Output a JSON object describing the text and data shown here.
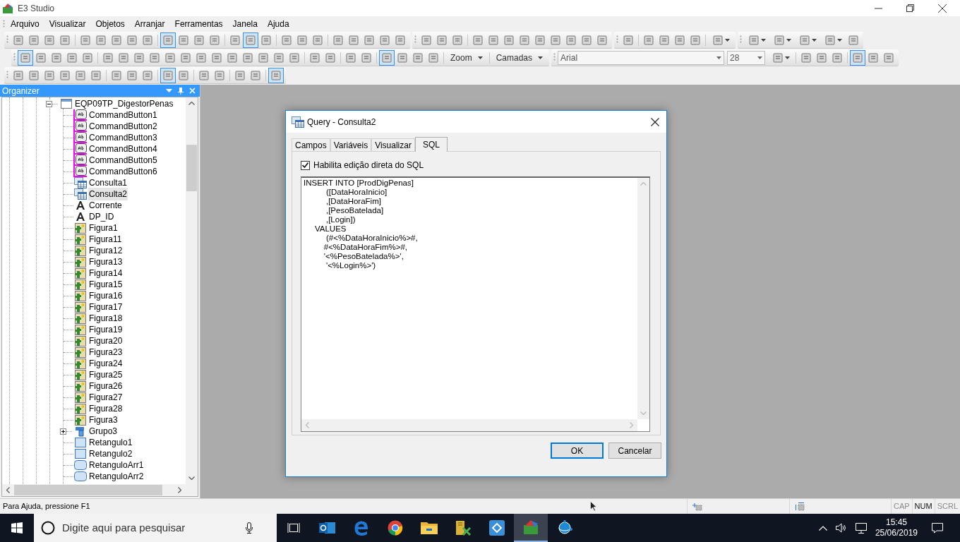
{
  "window": {
    "title": "E3 Studio"
  },
  "menu": [
    "Arquivo",
    "Visualizar",
    "Objetos",
    "Arranjar",
    "Ferramentas",
    "Janela",
    "Ajuda"
  ],
  "toolbar_rows": [
    [
      {
        "items": [
          {
            "kind": "button",
            "pressed": false
          },
          {
            "kind": "button",
            "pressed": false
          },
          {
            "kind": "button",
            "pressed": false
          },
          {
            "kind": "button",
            "pressed": false
          },
          {
            "kind": "separator"
          },
          {
            "kind": "button",
            "pressed": false
          },
          {
            "kind": "button",
            "pressed": false
          },
          {
            "kind": "button",
            "pressed": false
          },
          {
            "kind": "button",
            "pressed": false
          },
          {
            "kind": "button",
            "pressed": false
          },
          {
            "kind": "separator"
          },
          {
            "kind": "button",
            "pressed": true
          },
          {
            "kind": "button",
            "pressed": false
          },
          {
            "kind": "button",
            "pressed": false
          },
          {
            "kind": "button",
            "pressed": false
          },
          {
            "kind": "separator"
          },
          {
            "kind": "button",
            "pressed": false
          },
          {
            "kind": "button",
            "pressed": true
          },
          {
            "kind": "button",
            "pressed": false
          },
          {
            "kind": "separator"
          },
          {
            "kind": "button",
            "pressed": false
          },
          {
            "kind": "button",
            "pressed": false
          },
          {
            "kind": "button",
            "pressed": false
          },
          {
            "kind": "separator"
          },
          {
            "kind": "button",
            "pressed": false
          },
          {
            "kind": "button",
            "pressed": false
          },
          {
            "kind": "button",
            "pressed": false
          },
          {
            "kind": "button",
            "pressed": false
          },
          {
            "kind": "button",
            "pressed": false
          }
        ]
      },
      {
        "items": [
          {
            "kind": "button",
            "pressed": false
          },
          {
            "kind": "button",
            "pressed": false
          },
          {
            "kind": "button",
            "pressed": false
          },
          {
            "kind": "separator"
          },
          {
            "kind": "button",
            "pressed": false
          },
          {
            "kind": "button",
            "pressed": false
          },
          {
            "kind": "button",
            "pressed": false
          },
          {
            "kind": "button",
            "pressed": false
          },
          {
            "kind": "button",
            "pressed": false
          },
          {
            "kind": "button",
            "pressed": false
          },
          {
            "kind": "button",
            "pressed": false
          },
          {
            "kind": "button",
            "pressed": false
          },
          {
            "kind": "button",
            "pressed": false
          }
        ]
      },
      {
        "items": [
          {
            "kind": "button",
            "pressed": false
          },
          {
            "kind": "separator"
          },
          {
            "kind": "button",
            "pressed": false
          },
          {
            "kind": "button",
            "pressed": false
          },
          {
            "kind": "button",
            "pressed": false
          },
          {
            "kind": "button",
            "pressed": false
          },
          {
            "kind": "separator"
          },
          {
            "kind": "dropdown",
            "pressed": false
          }
        ]
      },
      {
        "items": [
          {
            "kind": "dropdown",
            "pressed": false
          },
          {
            "kind": "dropdown",
            "pressed": false
          },
          {
            "kind": "dropdown",
            "pressed": false
          },
          {
            "kind": "dropdown",
            "pressed": false
          },
          {
            "kind": "button",
            "pressed": false
          }
        ]
      }
    ],
    [
      {
        "items": [
          {
            "kind": "button",
            "pressed": true
          },
          {
            "kind": "button",
            "pressed": false
          },
          {
            "kind": "button",
            "pressed": false
          },
          {
            "kind": "button",
            "pressed": false
          },
          {
            "kind": "button",
            "pressed": false
          },
          {
            "kind": "separator"
          },
          {
            "kind": "button",
            "pressed": false
          },
          {
            "kind": "button",
            "pressed": false
          },
          {
            "kind": "button",
            "pressed": false
          },
          {
            "kind": "button",
            "pressed": false
          },
          {
            "kind": "button",
            "pressed": false
          },
          {
            "kind": "button",
            "pressed": false
          },
          {
            "kind": "button",
            "pressed": false
          },
          {
            "kind": "button",
            "pressed": false
          },
          {
            "kind": "button",
            "pressed": false
          },
          {
            "kind": "button",
            "pressed": false
          },
          {
            "kind": "button",
            "pressed": false
          },
          {
            "kind": "button",
            "pressed": false
          },
          {
            "kind": "button",
            "pressed": false
          },
          {
            "kind": "separator"
          },
          {
            "kind": "button",
            "pressed": false
          },
          {
            "kind": "button",
            "pressed": false
          },
          {
            "kind": "separator"
          },
          {
            "kind": "button",
            "pressed": false
          },
          {
            "kind": "button",
            "pressed": false
          },
          {
            "kind": "separator"
          },
          {
            "kind": "button",
            "pressed": true
          },
          {
            "kind": "button",
            "pressed": false
          },
          {
            "kind": "button",
            "pressed": false
          },
          {
            "kind": "button",
            "pressed": false
          },
          {
            "kind": "separator"
          },
          {
            "kind": "menu",
            "label": "Zoom"
          },
          {
            "kind": "separator"
          },
          {
            "kind": "menu",
            "label": "Camadas"
          }
        ]
      },
      {
        "items": [
          {
            "kind": "font-name",
            "value": "Arial"
          },
          {
            "kind": "font-size",
            "value": "28"
          },
          {
            "kind": "dropdown",
            "pressed": false
          },
          {
            "kind": "separator"
          },
          {
            "kind": "button",
            "pressed": false
          },
          {
            "kind": "button",
            "pressed": false
          },
          {
            "kind": "button",
            "pressed": false
          },
          {
            "kind": "separator"
          },
          {
            "kind": "button",
            "pressed": true
          },
          {
            "kind": "button",
            "pressed": false
          },
          {
            "kind": "button",
            "pressed": false
          }
        ]
      }
    ],
    [
      {
        "items": [
          {
            "kind": "button",
            "pressed": false
          },
          {
            "kind": "button",
            "pressed": false
          },
          {
            "kind": "button",
            "pressed": false
          },
          {
            "kind": "button",
            "pressed": false
          },
          {
            "kind": "button",
            "pressed": false
          },
          {
            "kind": "button",
            "pressed": false
          },
          {
            "kind": "separator"
          },
          {
            "kind": "button",
            "pressed": false
          },
          {
            "kind": "button",
            "pressed": false
          },
          {
            "kind": "button",
            "pressed": false
          },
          {
            "kind": "separator"
          },
          {
            "kind": "button",
            "pressed": true
          },
          {
            "kind": "button",
            "pressed": false
          },
          {
            "kind": "separator"
          },
          {
            "kind": "button",
            "pressed": false
          },
          {
            "kind": "button",
            "pressed": false
          },
          {
            "kind": "separator"
          },
          {
            "kind": "button",
            "pressed": false
          },
          {
            "kind": "button",
            "pressed": false
          },
          {
            "kind": "separator"
          },
          {
            "kind": "button",
            "pressed": true
          }
        ]
      }
    ]
  ],
  "organizer": {
    "title": "Organizer",
    "tree": [
      {
        "label": "EQP09TP_DigestorPenas",
        "kind": "screen",
        "expanded": true,
        "selected": false,
        "children": [
          {
            "label": "CommandButton1",
            "kind": "button",
            "marked": true,
            "selected": false
          },
          {
            "label": "CommandButton2",
            "kind": "button",
            "marked": true,
            "selected": false
          },
          {
            "label": "CommandButton3",
            "kind": "button",
            "marked": true,
            "selected": false
          },
          {
            "label": "CommandButton4",
            "kind": "button",
            "marked": true,
            "selected": false
          },
          {
            "label": "CommandButton5",
            "kind": "button",
            "marked": true,
            "selected": false
          },
          {
            "label": "CommandButton6",
            "kind": "button",
            "marked": true,
            "selected": false
          },
          {
            "label": "Consulta1",
            "kind": "query",
            "selected": false
          },
          {
            "label": "Consulta2",
            "kind": "query",
            "selected": true
          },
          {
            "label": "Corrente",
            "kind": "text",
            "selected": false
          },
          {
            "label": "DP_ID",
            "kind": "text",
            "selected": false
          },
          {
            "label": "Figura1",
            "kind": "image",
            "selected": false
          },
          {
            "label": "Figura11",
            "kind": "image",
            "selected": false
          },
          {
            "label": "Figura12",
            "kind": "image",
            "selected": false
          },
          {
            "label": "Figura13",
            "kind": "image",
            "selected": false
          },
          {
            "label": "Figura14",
            "kind": "image",
            "selected": false
          },
          {
            "label": "Figura15",
            "kind": "image",
            "selected": false
          },
          {
            "label": "Figura16",
            "kind": "image",
            "selected": false
          },
          {
            "label": "Figura17",
            "kind": "image",
            "selected": false
          },
          {
            "label": "Figura18",
            "kind": "image",
            "selected": false
          },
          {
            "label": "Figura19",
            "kind": "image",
            "selected": false
          },
          {
            "label": "Figura20",
            "kind": "image",
            "selected": false
          },
          {
            "label": "Figura23",
            "kind": "image",
            "selected": false
          },
          {
            "label": "Figura24",
            "kind": "image",
            "selected": false
          },
          {
            "label": "Figura25",
            "kind": "image",
            "selected": false
          },
          {
            "label": "Figura26",
            "kind": "image",
            "selected": false
          },
          {
            "label": "Figura27",
            "kind": "image",
            "selected": false
          },
          {
            "label": "Figura28",
            "kind": "image",
            "selected": false
          },
          {
            "label": "Figura3",
            "kind": "image",
            "selected": false
          },
          {
            "label": "Grupo3",
            "kind": "group",
            "expanded": false,
            "selected": false
          },
          {
            "label": "Retangulo1",
            "kind": "rect",
            "selected": false
          },
          {
            "label": "Retangulo2",
            "kind": "rect",
            "selected": false
          },
          {
            "label": "RetanguloArr1",
            "kind": "roundrect",
            "selected": false
          },
          {
            "label": "RetanguloArr2",
            "kind": "roundrect",
            "selected": false
          }
        ]
      }
    ]
  },
  "dialog": {
    "title": "Query - Consulta2",
    "tabs": [
      {
        "label": "Campos",
        "selected": false
      },
      {
        "label": "Variáveis",
        "selected": false
      },
      {
        "label": "Visualizar",
        "selected": false
      },
      {
        "label": "SQL",
        "selected": true
      }
    ],
    "checkbox": {
      "label": "Habilita edição direta do SQL",
      "checked": true
    },
    "sql": "INSERT INTO [ProdDigPenas]\n          ([DataHoraInicio]\n          ,[DataHoraFim]\n          ,[PesoBatelada]\n          ,[Login])\n     VALUES\n          (#<%DataHoraInicio%>#,\n         #<%DataHoraFim%>#,\n         '<%PesoBatelada%>',\n          '<%Login%>')",
    "buttons": [
      {
        "label": "OK",
        "default": true
      },
      {
        "label": "Cancelar",
        "default": false
      }
    ]
  },
  "status_bar": {
    "text": "Para Ajuda, pressione F1",
    "indicators": [
      {
        "label": "CAP",
        "on": false
      },
      {
        "label": "NUM",
        "on": true
      },
      {
        "label": "SCRL",
        "on": false
      }
    ]
  },
  "taskbar": {
    "search_placeholder": "Digite aqui para pesquisar",
    "apps": [
      {
        "kind": "mail",
        "active": false
      },
      {
        "kind": "edge",
        "active": false
      },
      {
        "kind": "chrome",
        "active": false
      },
      {
        "kind": "folder",
        "active": false
      },
      {
        "kind": "tools",
        "active": false
      },
      {
        "kind": "remote",
        "active": false
      },
      {
        "kind": "e3",
        "active": true
      },
      {
        "kind": "elipse",
        "active": false
      }
    ],
    "time": "15:45",
    "date": "25/06/2019"
  }
}
